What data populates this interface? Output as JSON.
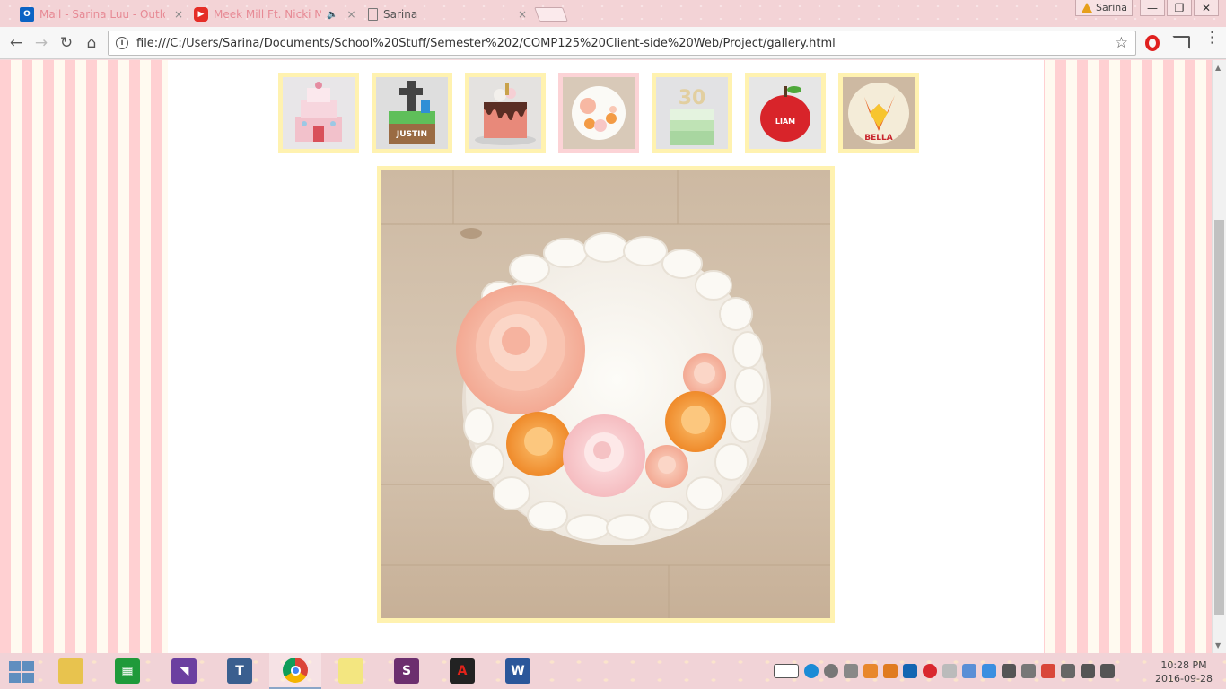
{
  "browser": {
    "tabs": [
      {
        "label": "Mail - Sarina Luu - Outlook",
        "favicon": "outlook-icon",
        "active": false
      },
      {
        "label": "Meek Mill Ft. Nicki Minaj",
        "favicon": "youtube-icon",
        "active": false,
        "audio": true
      },
      {
        "label": "Sarina",
        "favicon": "file-icon",
        "active": true
      }
    ],
    "profile_name": "Sarina",
    "address": "file:///C:/Users/Sarina/Documents/School%20Stuff/Semester%202/COMP125%20Client-side%20Web/Project/gallery.html",
    "icons": {
      "back": "←",
      "forward": "→",
      "reload": "↻",
      "home": "⌂",
      "info": "i",
      "star": "☆",
      "menu": "⋮",
      "close": "×",
      "minimize": "—",
      "maximize": "❐",
      "window_close": "✕",
      "audio": "🔈"
    }
  },
  "gallery": {
    "thumbnails": [
      {
        "subject": "pink tiered princess cake",
        "selected": false
      },
      {
        "subject": "minecraft cake Justin",
        "selected": false
      },
      {
        "subject": "pink drip cake",
        "selected": false
      },
      {
        "subject": "white cake with roses",
        "selected": true
      },
      {
        "subject": "green ombre 30 cake",
        "selected": false
      },
      {
        "subject": "red apple cake Liam",
        "selected": false
      },
      {
        "subject": "Happy Birthday Bella cake",
        "selected": false
      }
    ],
    "main_image": "white cake with roses"
  },
  "taskbar": {
    "apps": [
      "file-explorer",
      "windows-store",
      "visual-studio",
      "typora",
      "chrome",
      "sticky-notes",
      "slack",
      "adobe-reader",
      "word"
    ],
    "clock_time": "10:28 PM",
    "clock_date": "2016-09-28"
  },
  "colors": {
    "stripe_pink": "#ffd0d2",
    "stripe_cream": "#fffaf0",
    "thumb_border": "#fff2b0",
    "thumb_selected_border": "#fcd3d6"
  }
}
